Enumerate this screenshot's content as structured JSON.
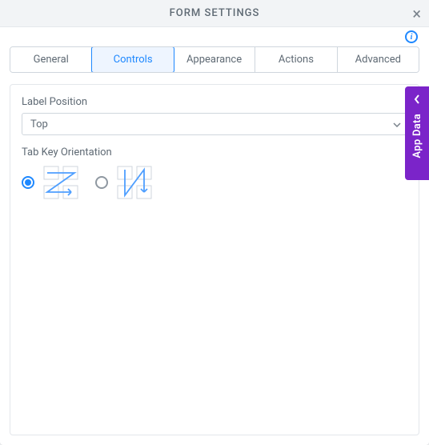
{
  "dialog": {
    "title": "FORM SETTINGS"
  },
  "tabs": {
    "items": [
      {
        "label": "General"
      },
      {
        "label": "Controls"
      },
      {
        "label": "Appearance"
      },
      {
        "label": "Actions"
      },
      {
        "label": "Advanced"
      }
    ],
    "active_index": 1
  },
  "fields": {
    "label_position": {
      "label": "Label Position",
      "value": "Top"
    },
    "tab_key_orientation": {
      "label": "Tab Key Orientation",
      "selected": "horizontal"
    }
  },
  "side_panel": {
    "label": "App Data"
  }
}
